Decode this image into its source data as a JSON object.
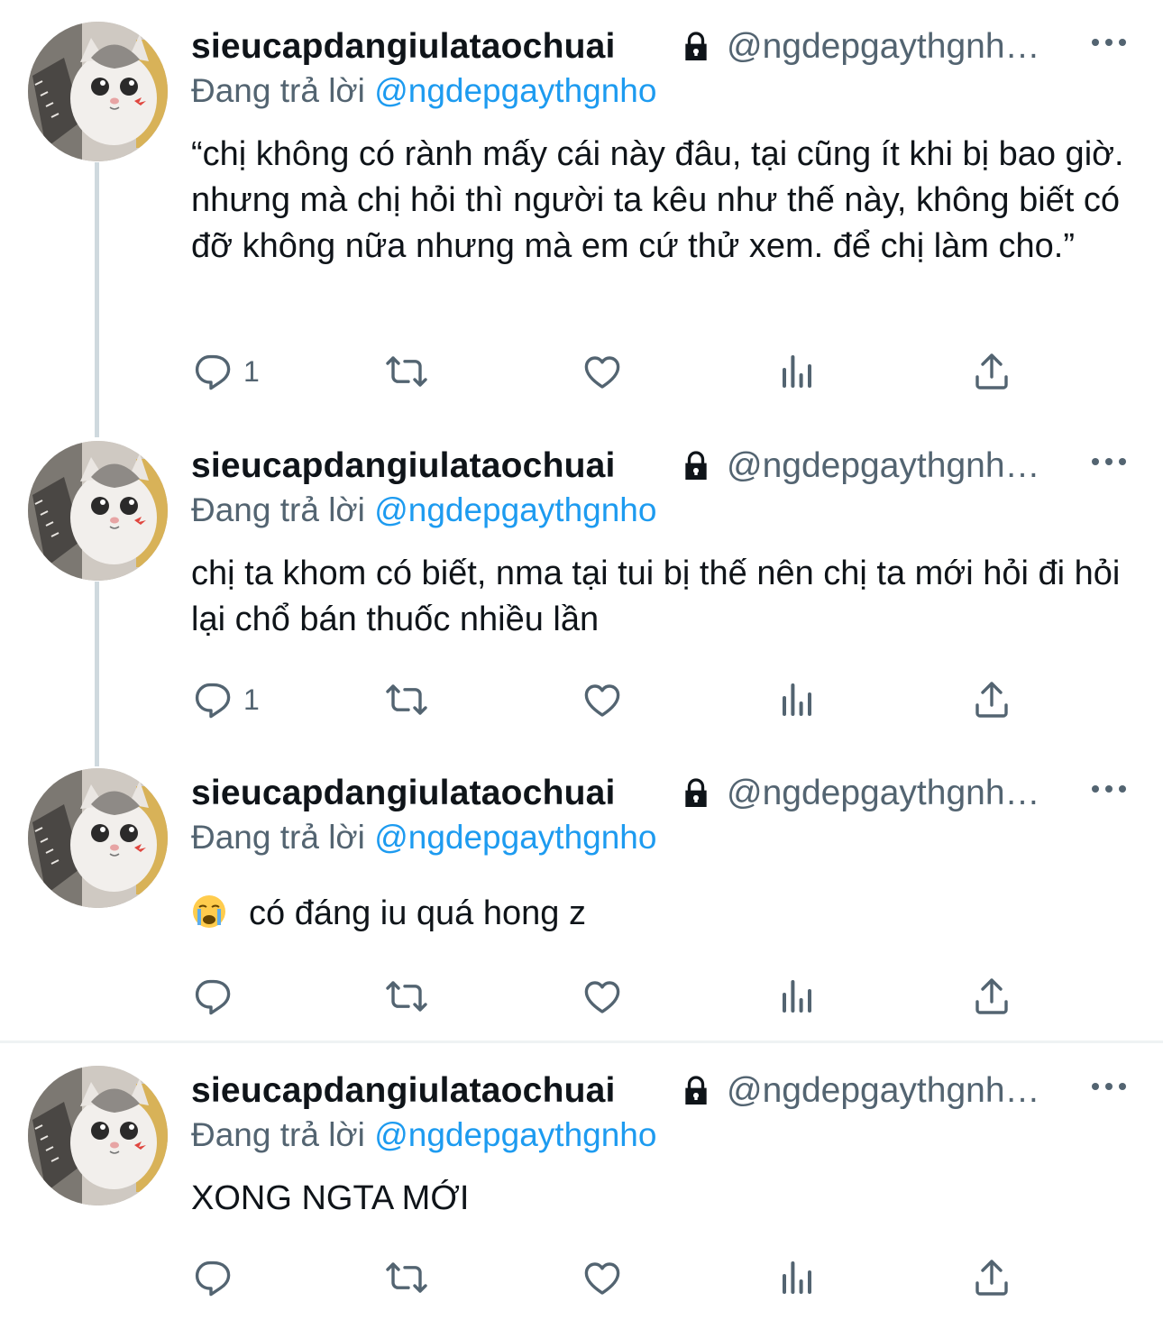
{
  "tweets": [
    {
      "name": "sieucapdangiulataochuai",
      "handle": "@ngdepgaythgnh…",
      "reply_prefix": "Đang trả lời",
      "reply_mention": "@ngdepgaythgnho",
      "text": "“chị không có rành mấy cái này đâu, tại cũng ít khi bị bao giờ. nhưng mà chị hỏi thì người ta kêu như thế này, không biết có đỡ không nữa nhưng mà em cứ thử xem. để chị làm cho.”",
      "reply_count": "1"
    },
    {
      "name": "sieucapdangiulataochuai",
      "handle": "@ngdepgaythgnh…",
      "reply_prefix": "Đang trả lời",
      "reply_mention": "@ngdepgaythgnho",
      "text": "chị ta khom có biết, nma tại tui bị thế nên chị ta mới hỏi đi hỏi lại chổ bán thuốc nhiều lần",
      "reply_count": "1"
    },
    {
      "name": "sieucapdangiulataochuai",
      "handle": "@ngdepgaythgnh…",
      "reply_prefix": "Đang trả lời",
      "reply_mention": "@ngdepgaythgnho",
      "emoji": "loudly-crying-face",
      "text": "có đáng iu quá hong z",
      "reply_count": ""
    },
    {
      "name": "sieucapdangiulataochuai",
      "handle": "@ngdepgaythgnh…",
      "reply_prefix": "Đang trả lời",
      "reply_mention": "@ngdepgaythgnho",
      "text": "XONG NGTA MỚI",
      "reply_count": ""
    }
  ],
  "icons": {
    "reply": "reply-icon",
    "retweet": "retweet-icon",
    "like": "like-icon",
    "views": "views-icon",
    "share": "share-icon",
    "lock": "lock-icon",
    "more": "more-icon"
  },
  "colors": {
    "name": "#0f1419",
    "secondary": "#536471",
    "mention": "#1d9bf0",
    "thread_line": "#cfd9de"
  }
}
